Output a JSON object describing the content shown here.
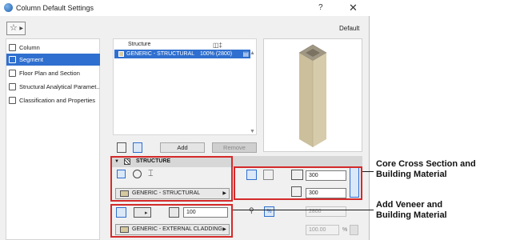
{
  "window": {
    "title": "Column Default Settings",
    "help_glyph": "?",
    "close_glyph": "✕",
    "favorites_glyph": "☆",
    "preset_label": "Default"
  },
  "nav": {
    "items": [
      {
        "label": "Column",
        "icon": "column-icon",
        "active": false
      },
      {
        "label": "Segment",
        "icon": "segment-icon",
        "active": true
      },
      {
        "label": "Floor Plan and Section",
        "icon": "floor-plan-icon",
        "active": false
      },
      {
        "label": "Structural Analytical Paramet...",
        "icon": "structural-analytical-icon",
        "active": false
      },
      {
        "label": "Classification and Properties",
        "icon": "classification-icon",
        "active": false
      }
    ]
  },
  "structure_list": {
    "header_structure": "Structure",
    "header_icon": "◫‡",
    "rows": [
      {
        "name": "GENERIC - STRUCTURAL",
        "value": "100% (2800)"
      }
    ],
    "add_label": "Add",
    "remove_label": "Remove"
  },
  "structure_section": {
    "title": "STRUCTURE",
    "material": "GENERIC - STRUCTURAL",
    "width_value": "300",
    "depth_value": "300",
    "veneer_thickness": "100",
    "veneer_material": "GENERIC - EXTERNAL CLADDING",
    "height_value": "2800",
    "percent_value": "100.00",
    "percent_unit": "%",
    "percent_toggle": "%"
  },
  "callouts": {
    "core_line1": "Core Cross Section and",
    "core_line2": "Building Material",
    "veneer_line1": "Add Veneer and",
    "veneer_line2": "Building Material"
  },
  "colors": {
    "selection_blue": "#2f6fcf",
    "annotation_red": "#d42a2a",
    "column_beige": "#c9bfa0"
  }
}
